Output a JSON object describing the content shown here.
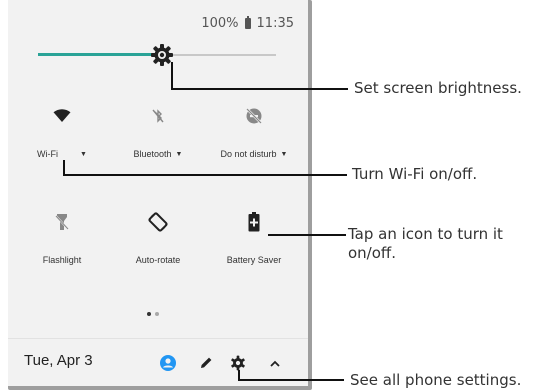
{
  "status": {
    "battery": "100%",
    "time": "11:35"
  },
  "brightness": {
    "level": 0.52
  },
  "tiles": [
    {
      "label": "Wi-Fi",
      "icon": "wifi-icon",
      "has_dropdown": true
    },
    {
      "label": "Bluetooth",
      "icon": "bluetooth-disabled-icon",
      "has_dropdown": true
    },
    {
      "label": "Do not disturb",
      "icon": "do-not-disturb-off-icon",
      "has_dropdown": true
    },
    {
      "label": "Flashlight",
      "icon": "flashlight-off-icon",
      "has_dropdown": false
    },
    {
      "label": "Auto-rotate",
      "icon": "auto-rotate-icon",
      "has_dropdown": false
    },
    {
      "label": "Battery Saver",
      "icon": "battery-saver-icon",
      "has_dropdown": false
    }
  ],
  "pager": {
    "pages": 2,
    "current": 1
  },
  "bottom_bar": {
    "date": "Tue, Apr 3"
  },
  "callouts": {
    "brightness": "Set screen brightness.",
    "wifi": "Turn Wi-Fi on/off.",
    "tap_icon_line1": "Tap an icon to turn it",
    "tap_icon_line2": "on/off.",
    "settings": "See all phone settings."
  },
  "colors": {
    "accent": "#2aa397",
    "icon_active": "#222222",
    "icon_inactive": "#888888",
    "user_icon": "#2196f3"
  }
}
